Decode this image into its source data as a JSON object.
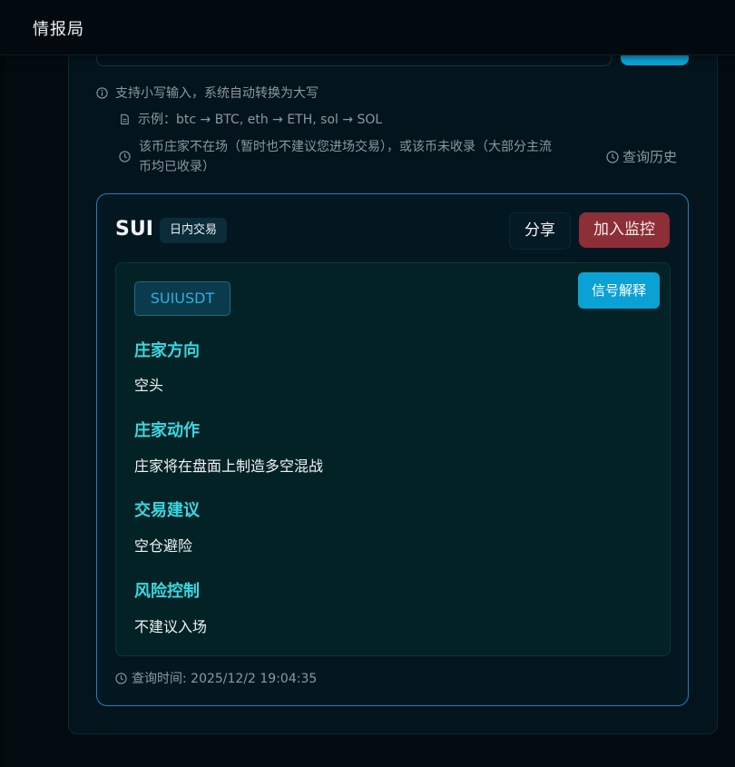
{
  "app": {
    "title": "情报局"
  },
  "hints": {
    "line1": "支持小写输入，系统自动转换为大写",
    "line2": "示例：btc → BTC, eth → ETH, sol → SOL",
    "line3a": "该币庄家不在场（暂时也不建议您进场交易），或该币未收录（大部分主流",
    "line3b": "币均已收录）",
    "history": "查询历史"
  },
  "result": {
    "symbol": "SUI",
    "mode_badge": "日内交易",
    "share_label": "分享",
    "monitor_label": "加入监控",
    "pair": "SUIUSDT",
    "explain_label": "信号解释",
    "sections": [
      {
        "title": "庄家方向",
        "value": "空头"
      },
      {
        "title": "庄家动作",
        "value": "庄家将在盘面上制造多空混战"
      },
      {
        "title": "交易建议",
        "value": "空仓避险"
      },
      {
        "title": "风险控制",
        "value": "不建议入场"
      }
    ],
    "query_time": "查询时间: 2025/12/2 19:04:35"
  },
  "colors": {
    "accent": "#0aa1d4",
    "danger": "#8c2f36",
    "section_title": "#38d8e0",
    "card_border": "#1f7fbd"
  },
  "icons": [
    "info-icon",
    "document-icon",
    "clock-icon"
  ]
}
